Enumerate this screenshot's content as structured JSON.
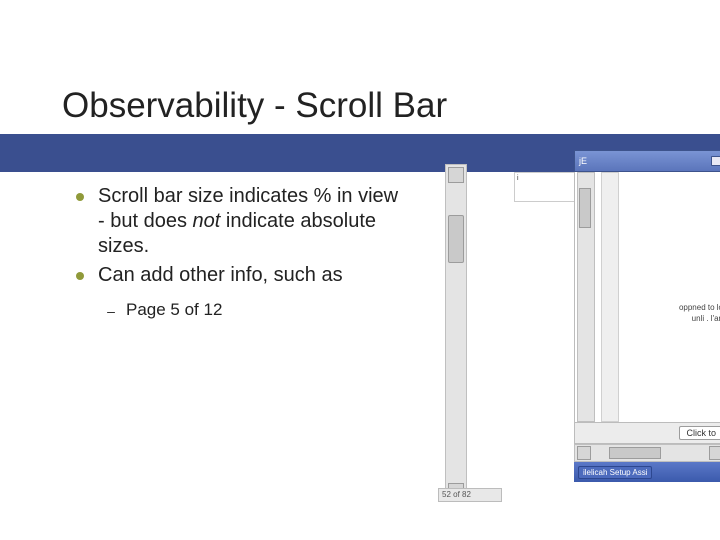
{
  "title": "Observability - Scroll Bar",
  "bullets": [
    {
      "text_pre": "Scroll bar size indicates % in view - but does ",
      "text_em": "not",
      "text_post": " indicate absolute sizes."
    },
    {
      "text_pre": "Can add other info, such as",
      "text_em": "",
      "text_post": ""
    }
  ],
  "sub_bullets": [
    "Page 5 of 12"
  ],
  "right_fragment": {
    "window_tab": "jE",
    "line1": "oppned to lo",
    "line2": "unli . l'an",
    "button": "Click to",
    "taskbar_item": "ilelicah Setup Assi"
  },
  "bottom_status": "52 of 82",
  "small_badge": "i"
}
